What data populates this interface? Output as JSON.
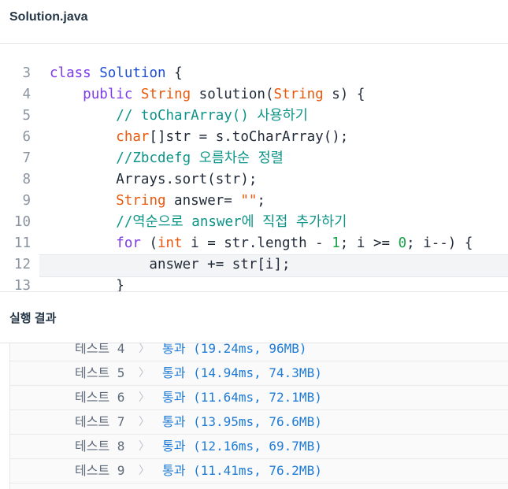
{
  "file": {
    "title": "Solution.java"
  },
  "code_lines": [
    {
      "num": "3",
      "tokens": [
        {
          "t": "class",
          "c": "kw"
        },
        {
          "t": " "
        },
        {
          "t": "Solution",
          "c": "cls"
        },
        {
          "t": " {"
        }
      ]
    },
    {
      "num": "4",
      "tokens": [
        {
          "t": "    "
        },
        {
          "t": "public",
          "c": "kw"
        },
        {
          "t": " "
        },
        {
          "t": "String",
          "c": "type"
        },
        {
          "t": " solution("
        },
        {
          "t": "String",
          "c": "type"
        },
        {
          "t": " s) {"
        }
      ]
    },
    {
      "num": "5",
      "tokens": [
        {
          "t": "        "
        },
        {
          "t": "// toCharArray() 사용하기",
          "c": "cm"
        }
      ]
    },
    {
      "num": "6",
      "tokens": [
        {
          "t": "        "
        },
        {
          "t": "char",
          "c": "type"
        },
        {
          "t": "[]str = s.toCharArray();"
        }
      ]
    },
    {
      "num": "7",
      "tokens": [
        {
          "t": "        "
        },
        {
          "t": "//Zbcdefg 오름차순 정렬",
          "c": "cm"
        }
      ]
    },
    {
      "num": "8",
      "tokens": [
        {
          "t": "        Arrays.sort(str);"
        }
      ]
    },
    {
      "num": "9",
      "tokens": [
        {
          "t": "        "
        },
        {
          "t": "String",
          "c": "type"
        },
        {
          "t": " answer= "
        },
        {
          "t": "\"\"",
          "c": "type"
        },
        {
          "t": ";"
        }
      ]
    },
    {
      "num": "10",
      "tokens": [
        {
          "t": "        "
        },
        {
          "t": "//역순으로 answer에 직접 추가하기",
          "c": "cm"
        }
      ]
    },
    {
      "num": "11",
      "tokens": [
        {
          "t": "        "
        },
        {
          "t": "for",
          "c": "kw"
        },
        {
          "t": " ("
        },
        {
          "t": "int",
          "c": "type"
        },
        {
          "t": " i = str.length - "
        },
        {
          "t": "1",
          "c": "num"
        },
        {
          "t": "; i >= "
        },
        {
          "t": "0",
          "c": "num"
        },
        {
          "t": "; i--) {"
        }
      ]
    },
    {
      "num": "12",
      "active": true,
      "tokens": [
        {
          "t": "            answer += str[i];"
        }
      ]
    },
    {
      "num": "13",
      "tokens": [
        {
          "t": "        }"
        }
      ]
    }
  ],
  "results_section": {
    "title": "실행 결과"
  },
  "test_results": [
    {
      "label": "테스트 4",
      "chevron": "〉",
      "result": "통과 (19.24ms, 96MB)"
    },
    {
      "label": "테스트 5",
      "chevron": "〉",
      "result": "통과 (14.94ms, 74.3MB)"
    },
    {
      "label": "테스트 6",
      "chevron": "〉",
      "result": "통과 (11.64ms, 72.1MB)"
    },
    {
      "label": "테스트 7",
      "chevron": "〉",
      "result": "통과 (13.95ms, 76.6MB)"
    },
    {
      "label": "테스트 8",
      "chevron": "〉",
      "result": "통과 (12.16ms, 69.7MB)"
    },
    {
      "label": "테스트 9",
      "chevron": "〉",
      "result": "통과 (11.41ms, 76.2MB)"
    }
  ]
}
